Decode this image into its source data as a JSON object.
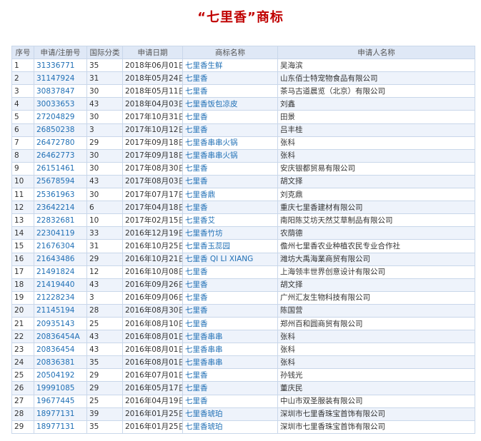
{
  "title": "“七里香”商标",
  "table": {
    "headers": [
      "序号",
      "申请/注册号",
      "国际分类",
      "申请日期",
      "商标名称",
      "申请人名称"
    ],
    "rows": [
      [
        "1",
        "31336771",
        "35",
        "2018年06月01日",
        "七里香生鲜",
        "吴海滨"
      ],
      [
        "2",
        "31147924",
        "31",
        "2018年05月24日",
        "七里香",
        "山东佰士特宠物食品有限公司"
      ],
      [
        "3",
        "30837847",
        "30",
        "2018年05月11日",
        "七里香",
        "茶马古道晨览（北京）有限公司"
      ],
      [
        "4",
        "30033653",
        "43",
        "2018年04月03日",
        "七里香饭包凉皮",
        "刘鑫"
      ],
      [
        "5",
        "27204829",
        "30",
        "2017年10月31日",
        "七里香",
        "田景"
      ],
      [
        "6",
        "26850238",
        "3",
        "2017年10月12日",
        "七里香",
        "吕丰桂"
      ],
      [
        "7",
        "26472780",
        "29",
        "2017年09月18日",
        "七里香串串火锅",
        "张科"
      ],
      [
        "8",
        "26462773",
        "30",
        "2017年09月18日",
        "七里香串串火锅",
        "张科"
      ],
      [
        "9",
        "26151461",
        "30",
        "2017年08月30日",
        "七里香",
        "安庆银都贸易有限公司"
      ],
      [
        "10",
        "25678594",
        "43",
        "2017年08月03日",
        "七里香",
        "胡文择"
      ],
      [
        "11",
        "25361963",
        "30",
        "2017年07月17日",
        "七里香鼎",
        "刘克鼎"
      ],
      [
        "12",
        "23642214",
        "6",
        "2017年04月18日",
        "七里香",
        "重庆七里香建材有限公司"
      ],
      [
        "13",
        "22832681",
        "10",
        "2017年02月15日",
        "七里香艾",
        "南阳陈艾坊天然艾草制品有限公司"
      ],
      [
        "14",
        "22304119",
        "33",
        "2016年12月19日",
        "七里香竹坊",
        "农荫德"
      ],
      [
        "15",
        "21676304",
        "31",
        "2016年10月25日",
        "七里香玉蕊园",
        "儋州七里香农业种植农民专业合作社"
      ],
      [
        "16",
        "21643486",
        "29",
        "2016年10月21日",
        "七里香 QI LI XIANG",
        "潍坊大禹海業商贸有限公司"
      ],
      [
        "17",
        "21491824",
        "12",
        "2016年10月08日",
        "七里香",
        "上海领丰世界创意设计有限公司"
      ],
      [
        "18",
        "21419440",
        "43",
        "2016年09月26日",
        "七里香",
        "胡文择"
      ],
      [
        "19",
        "21228234",
        "3",
        "2016年09月06日",
        "七里香",
        "广州汇友生物科技有限公司"
      ],
      [
        "20",
        "21145194",
        "28",
        "2016年08月30日",
        "七里香",
        "陈国营"
      ],
      [
        "21",
        "20935143",
        "25",
        "2016年08月10日",
        "七里香",
        "郑州百和圆商贸有限公司"
      ],
      [
        "22",
        "20836454A",
        "43",
        "2016年08月01日",
        "七里香串串",
        "张科"
      ],
      [
        "23",
        "20836454",
        "43",
        "2016年08月01日",
        "七里香串串",
        "张科"
      ],
      [
        "24",
        "20836381",
        "35",
        "2016年08月01日",
        "七里香串串",
        "张科"
      ],
      [
        "25",
        "20504192",
        "29",
        "2016年07月01日",
        "七里香",
        "孙钱光"
      ],
      [
        "26",
        "19991085",
        "29",
        "2016年05月17日",
        "七里香",
        "董庆民"
      ],
      [
        "27",
        "19677445",
        "25",
        "2016年04月19日",
        "七里香",
        "中山市双圣服装有限公司"
      ],
      [
        "28",
        "18977131",
        "39",
        "2016年01月25日",
        "七里香琥珀",
        "深圳市七里香珠宝首饰有限公司"
      ],
      [
        "29",
        "18977131",
        "35",
        "2016年01月25日",
        "七里香琥珀",
        "深圳市七里香珠宝首饰有限公司"
      ]
    ]
  }
}
